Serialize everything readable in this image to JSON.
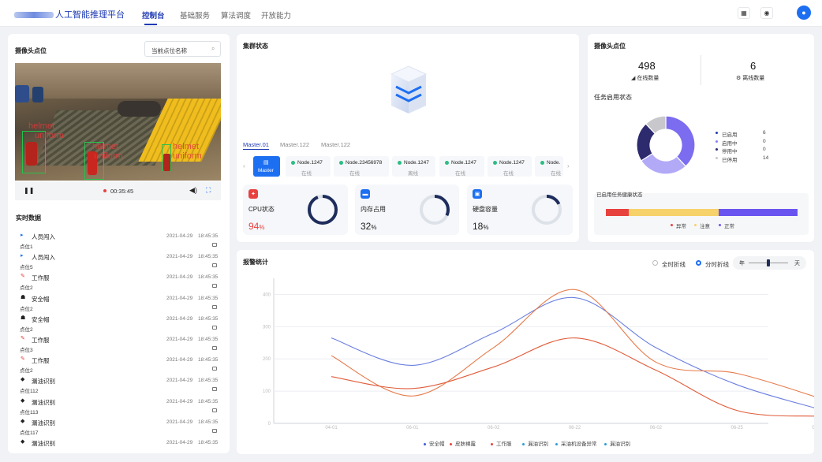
{
  "app": {
    "title": "人工智能推理平台"
  },
  "nav": {
    "items": [
      "控制台",
      "基础服务",
      "算法调度",
      "开放能力"
    ],
    "active": 0
  },
  "left": {
    "camera_title": "摄像头点位",
    "search_placeholder": "当前点位名称",
    "video_time": "00:35:45",
    "realtime_title": "实时数据",
    "detections": [
      "helmet",
      "helmet",
      "helmet"
    ],
    "detection_label": "uniform",
    "rows": [
      {
        "title": "人员闯入",
        "date": "2021-04-29",
        "time": "18:45:35",
        "loc": "点位1",
        "icon": "person"
      },
      {
        "title": "人员闯入",
        "date": "2021-04-29",
        "time": "18:45:35",
        "loc": "点位5",
        "icon": "person"
      },
      {
        "title": "工作服",
        "date": "2021-04-29",
        "time": "18:45:35",
        "loc": "点位2",
        "icon": "uniform"
      },
      {
        "title": "安全帽",
        "date": "2021-04-29",
        "time": "18:45:35",
        "loc": "点位2",
        "icon": "helmet"
      },
      {
        "title": "安全帽",
        "date": "2021-04-29",
        "time": "18:45:35",
        "loc": "点位2",
        "icon": "helmet"
      },
      {
        "title": "工作服",
        "date": "2021-04-29",
        "time": "18:45:35",
        "loc": "点位3",
        "icon": "uniform"
      },
      {
        "title": "工作服",
        "date": "2021-04-29",
        "time": "18:45:35",
        "loc": "点位2",
        "icon": "uniform"
      },
      {
        "title": "漏油识别",
        "date": "2021-04-29",
        "time": "18:45:35",
        "loc": "点位112",
        "icon": "oil"
      },
      {
        "title": "漏油识别",
        "date": "2021-04-29",
        "time": "18:45:35",
        "loc": "点位113",
        "icon": "oil"
      },
      {
        "title": "漏油识别",
        "date": "2021-04-29",
        "time": "18:45:35",
        "loc": "点位117",
        "icon": "oil"
      },
      {
        "title": "漏油识别",
        "date": "2021-04-29",
        "time": "18:45:35",
        "loc": "",
        "icon": "oil"
      }
    ]
  },
  "cluster": {
    "title": "集群状态",
    "master_tabs": [
      "Master.01",
      "Master.122",
      "Master.122"
    ],
    "nodes": [
      {
        "name": "Master",
        "status": ""
      },
      {
        "name": "Node.1247",
        "status": "在线"
      },
      {
        "name": "Node.23456978",
        "status": "在线"
      },
      {
        "name": "Node.1247",
        "status": "离线"
      },
      {
        "name": "Node.1247",
        "status": "在线"
      },
      {
        "name": "Node.1247",
        "status": "在线"
      },
      {
        "name": "Node.",
        "status": "在线"
      }
    ],
    "cards": [
      {
        "label": "CPU状态",
        "value": "94",
        "unit": "%",
        "percent": 94,
        "color": "#e8423f",
        "ring": "#1e2d5c"
      },
      {
        "label": "内存占用",
        "value": "32",
        "unit": "%",
        "percent": 32,
        "color": "#222",
        "ring": "#1e2d5c"
      },
      {
        "label": "硬盘容量",
        "value": "18",
        "unit": "%",
        "percent": 18,
        "color": "#222",
        "ring": "#1e2d5c"
      }
    ]
  },
  "right": {
    "title": "摄像头点位",
    "online_count": "498",
    "online_label": "在线数量",
    "offline_count": "6",
    "offline_label": "离线数量",
    "task_title": "任务启用状态",
    "legend": [
      {
        "name": "已启用",
        "value": "6",
        "color": "#1f3bb3"
      },
      {
        "name": "启用中",
        "value": "0",
        "color": "#8a7ef5"
      },
      {
        "name": "停用中",
        "value": "0",
        "color": "#2d2a6e"
      },
      {
        "name": "已停用",
        "value": "14",
        "color": "#c8c8cc"
      }
    ],
    "donut": [
      {
        "value": 38,
        "color": "#7b6cf0"
      },
      {
        "value": 28,
        "color": "#b2a9f7"
      },
      {
        "value": 22,
        "color": "#2d2a6e"
      },
      {
        "value": 12,
        "color": "#c8c8cc"
      }
    ],
    "health_title": "已启用任务健康状态",
    "health": [
      {
        "name": "异常",
        "value": 12,
        "color": "#e8423f"
      },
      {
        "name": "注意",
        "value": 47,
        "color": "#f7d26b"
      },
      {
        "name": "正常",
        "value": 41,
        "color": "#6b55f0"
      }
    ]
  },
  "alarm": {
    "title": "报警统计",
    "radio_all": "全时折线",
    "radio_split": "分时折线",
    "slider_left": "年",
    "slider_right": "天",
    "slider_value": 0.45,
    "legend": [
      {
        "name": "安全帽",
        "color": "#3b5bdb"
      },
      {
        "name": "皮肤裸露",
        "color": "#e8423f"
      },
      {
        "name": "工作服",
        "color": "#e8423f"
      },
      {
        "name": "漏油识别",
        "color": "#2d9cdb"
      },
      {
        "name": "采油机设备异常",
        "color": "#2d9cdb"
      },
      {
        "name": "漏油识别",
        "color": "#2d9cdb"
      }
    ]
  },
  "chart_data": {
    "type": "line",
    "x": [
      "04-01",
      "06-01",
      "06-02",
      "06-22",
      "06-02",
      "06-25",
      "06-06"
    ],
    "yticks": [
      0,
      100,
      200,
      300,
      400
    ],
    "ylim": [
      0,
      450
    ],
    "series": [
      {
        "color": "#6b7fe0",
        "values": [
          265,
          180,
          280,
          390,
          235,
          120,
          45
        ]
      },
      {
        "color": "#e67a4a",
        "values": [
          210,
          85,
          235,
          415,
          190,
          155,
          80
        ]
      },
      {
        "color": "#e05c3a",
        "values": [
          145,
          108,
          175,
          265,
          165,
          40,
          22
        ]
      }
    ]
  }
}
